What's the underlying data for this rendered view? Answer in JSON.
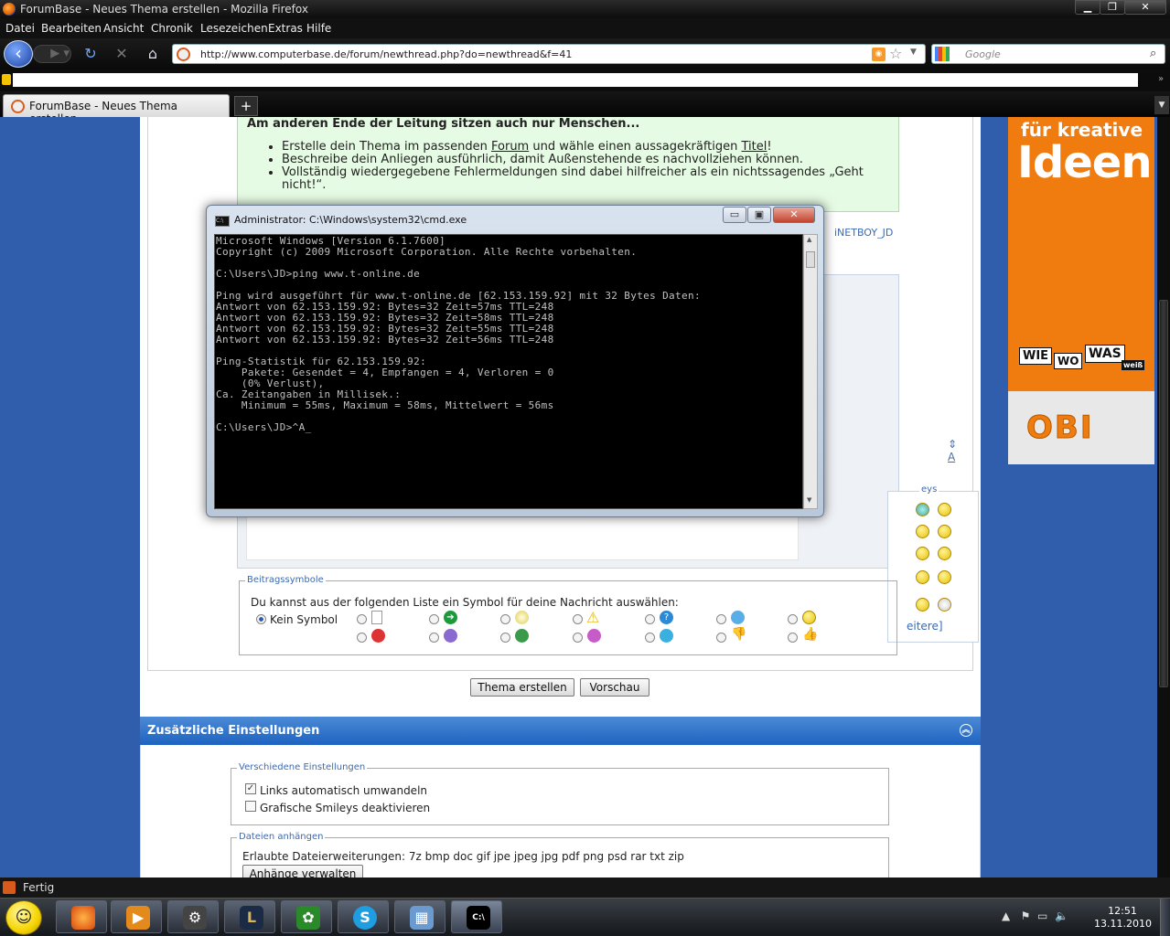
{
  "window": {
    "title": "ForumBase - Neues Thema erstellen - Mozilla Firefox"
  },
  "menu": [
    "Datei",
    "Bearbeiten",
    "Ansicht",
    "Chronik",
    "Lesezeichen",
    "Extras",
    "Hilfe"
  ],
  "nav": {
    "url": "http://www.computerbase.de/forum/newthread.php?do=newthread&f=41",
    "search_placeholder": "Google"
  },
  "tab": {
    "title": "ForumBase - Neues Thema erstellen",
    "new_tab": "+"
  },
  "hint": {
    "heading": "Am anderen Ende der Leitung sitzen auch nur Menschen...",
    "b1_pre": "Erstelle dein Thema im passenden ",
    "b1_link1": "Forum",
    "b1_mid": " und wähle einen aussagekräftigen ",
    "b1_link2": "Titel",
    "b1_end": "!",
    "b2": "Beschreibe dein Anliegen ausführlich, damit Außenstehende es nachvollziehen können.",
    "b3": "Vollständig wiedergegebene Fehlermeldungen sind dabei hilfreicher als ein nichtssagendes „Geht nicht!“."
  },
  "user_partial": "iNETBOY_JD",
  "smilies": {
    "legend_partial": "eys",
    "more_partial": "eitere]"
  },
  "symbols": {
    "legend": "Beitragssymbole",
    "prompt": "Du kannst aus der folgenden Liste ein Symbol für deine Nachricht auswählen:",
    "none": "Kein Symbol"
  },
  "buttons": {
    "create": "Thema erstellen",
    "preview": "Vorschau"
  },
  "extra": {
    "header": "Zusätzliche Einstellungen",
    "misc_legend": "Verschiedene Einstellungen",
    "auto_links": "Links automatisch umwandeln",
    "auto_links_checked": true,
    "no_smilies": "Grafische Smileys deaktivieren",
    "attach_legend": "Dateien anhängen",
    "allowed": "Erlaubte Dateierweiterungen: 7z bmp doc gif jpe jpeg jpg pdf png psd rar txt zip",
    "manage_button": "Anhänge verwalten"
  },
  "ad": {
    "line1": "für kreative",
    "line2": "Ideen",
    "wie": "WIE",
    "wo": "WO",
    "was": "WAS",
    "weiss": "weiß",
    "brand": "OBI"
  },
  "cmd": {
    "title": "Administrator: C:\\Windows\\system32\\cmd.exe",
    "text": "Microsoft Windows [Version 6.1.7600]\nCopyright (c) 2009 Microsoft Corporation. Alle Rechte vorbehalten.\n\nC:\\Users\\JD>ping www.t-online.de\n\nPing wird ausgeführt für www.t-online.de [62.153.159.92] mit 32 Bytes Daten:\nAntwort von 62.153.159.92: Bytes=32 Zeit=57ms TTL=248\nAntwort von 62.153.159.92: Bytes=32 Zeit=58ms TTL=248\nAntwort von 62.153.159.92: Bytes=32 Zeit=55ms TTL=248\nAntwort von 62.153.159.92: Bytes=32 Zeit=56ms TTL=248\n\nPing-Statistik für 62.153.159.92:\n    Pakete: Gesendet = 4, Empfangen = 4, Verloren = 0\n    (0% Verlust),\nCa. Zeitangaben in Millisek.:\n    Minimum = 55ms, Maximum = 58ms, Mittelwert = 56ms\n\nC:\\Users\\JD>^A_"
  },
  "status": {
    "text": "Fertig"
  },
  "clock": {
    "time": "12:51",
    "date": "13.11.2010"
  },
  "colors": {
    "accent": "#305eac",
    "header_blue": "#1d63c0",
    "hint_bg": "#e6fbe3",
    "ad_orange": "#f07c10"
  }
}
